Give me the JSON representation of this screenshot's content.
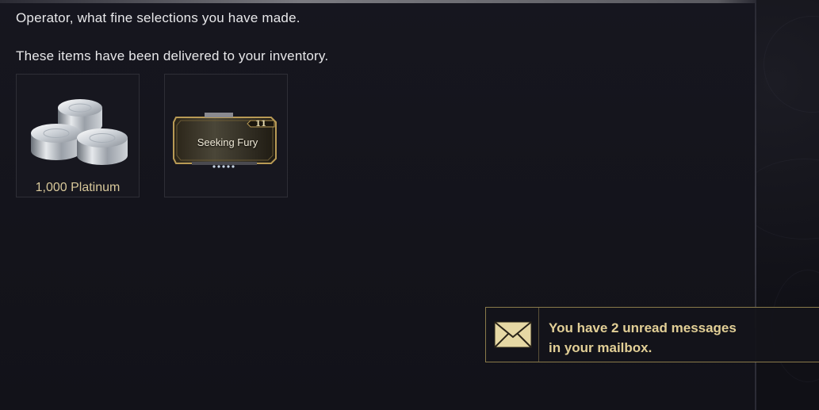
{
  "messages": {
    "line1": "Operator, what fine selections you have made.",
    "line2": "These items have been delivered to your inventory."
  },
  "items": [
    {
      "label": "1,000 Platinum",
      "icon": "platinum-coins-icon"
    },
    {
      "name": "Seeking Fury",
      "rank": "11",
      "icon": "mod-card-icon"
    }
  ],
  "notification": {
    "line1": "You have 2 unread messages",
    "line2": "in your mailbox.",
    "icon": "envelope-icon"
  },
  "colors": {
    "background": "#15151c",
    "gold_text": "#e2cf96",
    "platinum_label": "#d8c89a",
    "notification_border": "#8a7a4a"
  }
}
